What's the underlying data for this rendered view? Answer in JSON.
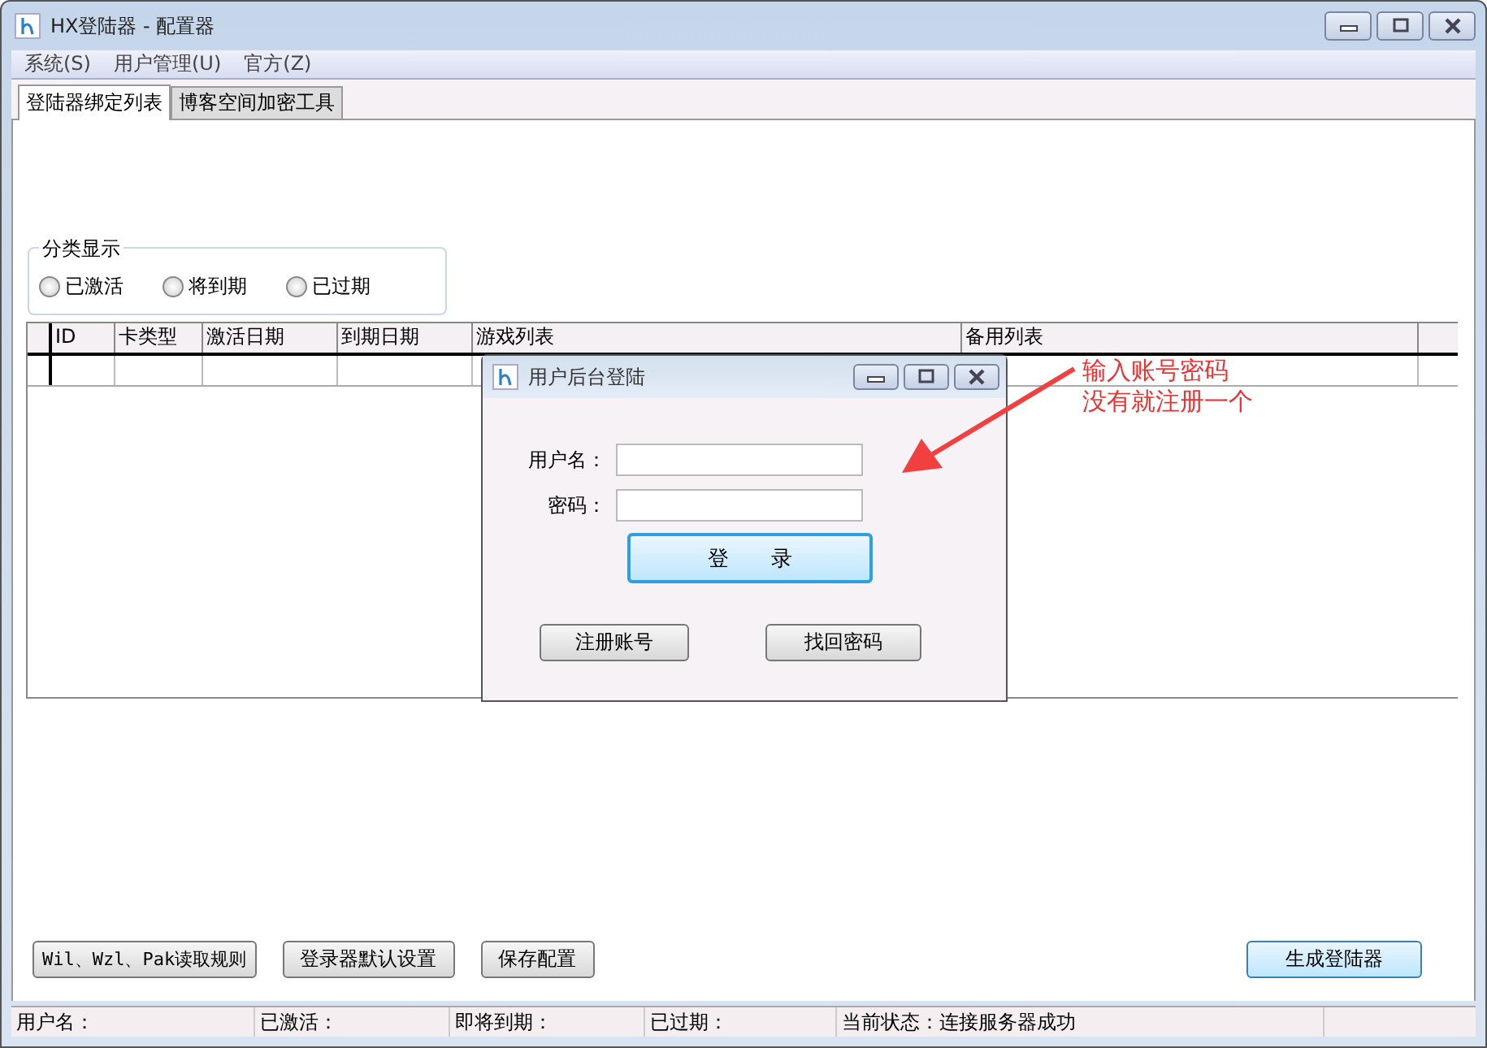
{
  "window": {
    "title": "HX登陆器 - 配置器"
  },
  "menu": [
    "系统(S)",
    "用户管理(U)",
    "官方(Z)"
  ],
  "tabs": [
    {
      "label": "登陆器绑定列表",
      "selected": true
    },
    {
      "label": "博客空间加密工具",
      "selected": false
    }
  ],
  "filter_group": {
    "title": "分类显示",
    "options": [
      {
        "label": "已激活",
        "selected": false
      },
      {
        "label": "将到期",
        "selected": false
      },
      {
        "label": "已过期",
        "selected": false
      }
    ]
  },
  "table": {
    "columns": [
      "ID",
      "卡类型",
      "激活日期",
      "到期日期",
      "游戏列表",
      "备用列表"
    ]
  },
  "dialog": {
    "title": "用户后台登陆",
    "fields": [
      {
        "label": "用户名："
      },
      {
        "label": "密码："
      }
    ],
    "login_button": "登　　录",
    "buttons": [
      "注册账号",
      "找回密码"
    ]
  },
  "annotation": {
    "lines": [
      "输入账号密码",
      "没有就注册一个"
    ]
  },
  "bottom_buttons": [
    {
      "label": "Wil、Wzl、Pak读取规则",
      "default": false
    },
    {
      "label": "登录器默认设置",
      "default": false
    },
    {
      "label": "保存配置",
      "default": false
    },
    {
      "label": "生成登陆器",
      "default": true
    }
  ],
  "status_bar": [
    "用户名：",
    "已激活：",
    "即将到期：",
    "已过期：",
    "当前状态：连接服务器成功"
  ]
}
